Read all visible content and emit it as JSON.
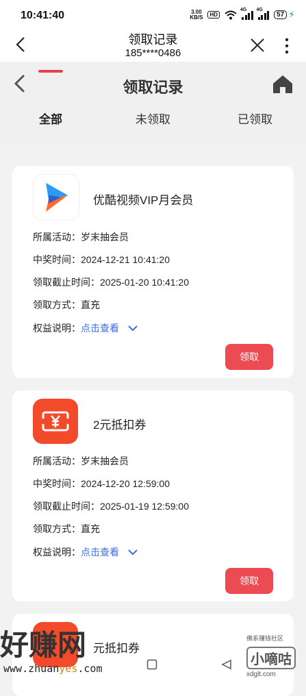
{
  "status": {
    "time": "10:41:40",
    "speed": "3.00",
    "speed_unit": "KB/S",
    "hd": "HD",
    "net1": "4G",
    "net2": "4G",
    "battery": "57"
  },
  "topbar": {
    "title": "领取记录",
    "subtitle": "185****0486"
  },
  "header": {
    "title": "领取记录",
    "tabs": [
      "全部",
      "未领取",
      "已领取"
    ],
    "active_tab": "全部"
  },
  "cards": [
    {
      "name": "优酷视频VIP月会员",
      "rows": [
        {
          "label": "所属活动：",
          "value": "岁末抽会员"
        },
        {
          "label": "中奖时间：",
          "value": "2024-12-21 10:41:20"
        },
        {
          "label": "领取截止时间：",
          "value": "2025-01-20 10:41:20"
        },
        {
          "label": "领取方式：",
          "value": "直充"
        }
      ],
      "benefit_label": "权益说明：",
      "benefit_link": "点击查看",
      "button": "领取"
    },
    {
      "name": "2元抵扣券",
      "rows": [
        {
          "label": "所属活动：",
          "value": "岁末抽会员"
        },
        {
          "label": "中奖时间：",
          "value": "2024-12-20 12:59:00"
        },
        {
          "label": "领取截止时间：",
          "value": "2025-01-19 12:59:00"
        },
        {
          "label": "领取方式：",
          "value": "直充"
        }
      ],
      "benefit_label": "权益说明：",
      "benefit_link": "点击查看",
      "button": "领取"
    },
    {
      "name": "元抵扣券"
    }
  ],
  "watermark": {
    "left": "好赚网",
    "url_a": "www.zhuan",
    "url_b": "yes",
    "url_c": ".com",
    "right_small": "佛系赚钱社区",
    "right_big": "小嘀咕",
    "right_url": "xdglt.com"
  },
  "colors": {
    "accent": "#ed4b54",
    "link": "#3f6be6"
  }
}
